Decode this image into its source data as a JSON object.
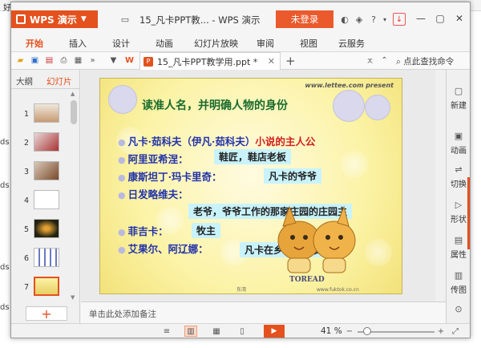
{
  "background": {
    "strip_text": [
      "好",
      "3",
      "中",
      "1",
      "差",
      "1"
    ],
    "left_margin_text": [
      "ds",
      "ds",
      "ds",
      "ds"
    ]
  },
  "titlebar": {
    "app_name": "WPS 演示",
    "doc_title": "15_凡卡PPT教... - WPS 演示",
    "login_label": "未登录",
    "help_label": "?"
  },
  "ribbon": {
    "tabs": [
      "开始",
      "插入",
      "设计",
      "动画",
      "幻灯片放映",
      "审阅",
      "视图",
      "云服务"
    ],
    "active_tab": "开始"
  },
  "toolbar": {
    "doc_tab_label": "15_凡卡PPT教学用.ppt *",
    "search_label": "点此查找命令"
  },
  "left_pane": {
    "tab_outline": "大纲",
    "tab_slides": "幻灯片",
    "slide_numbers": [
      "1",
      "2",
      "3",
      "4",
      "5",
      "6",
      "7"
    ],
    "active_slide": "7",
    "add_label": "+"
  },
  "slide": {
    "site": "www.lettee.com present",
    "title": "读准人名，并明确人物的身份",
    "bullets": [
      {
        "text": "凡卡·茹科夫（伊凡·茹科夫）",
        "extra": "小说的主人公"
      },
      {
        "text": "阿里亚希涅："
      },
      {
        "text": "康斯坦丁·玛卡里奇："
      },
      {
        "text": "日发略维夫："
      },
      {
        "text": "菲吉卡："
      },
      {
        "text": "艾果尔、阿辽娜："
      }
    ],
    "answers": [
      "鞋匠，鞋店老板",
      "凡卡的爷爷",
      "老爷，爷爷工作的那家庄园的庄园主",
      "牧主",
      "凡卡在乡下的朋友"
    ],
    "logo_text": "TOREAD",
    "footer_small": "www.fuktok.co.cn",
    "footer_left": "东湾"
  },
  "notes": {
    "placeholder": "单击此处添加备注"
  },
  "right_pane": {
    "items": [
      "新建",
      "动画",
      "切换",
      "形状",
      "属性",
      "传图"
    ]
  },
  "statusbar": {
    "zoom": "41 %",
    "zoom_fraction": 0.12
  },
  "colors": {
    "accent": "#e4511e",
    "slide_title": "#1a6b2e",
    "bullet_text": "#2233aa",
    "answer_bg": "#c9f3fb"
  }
}
